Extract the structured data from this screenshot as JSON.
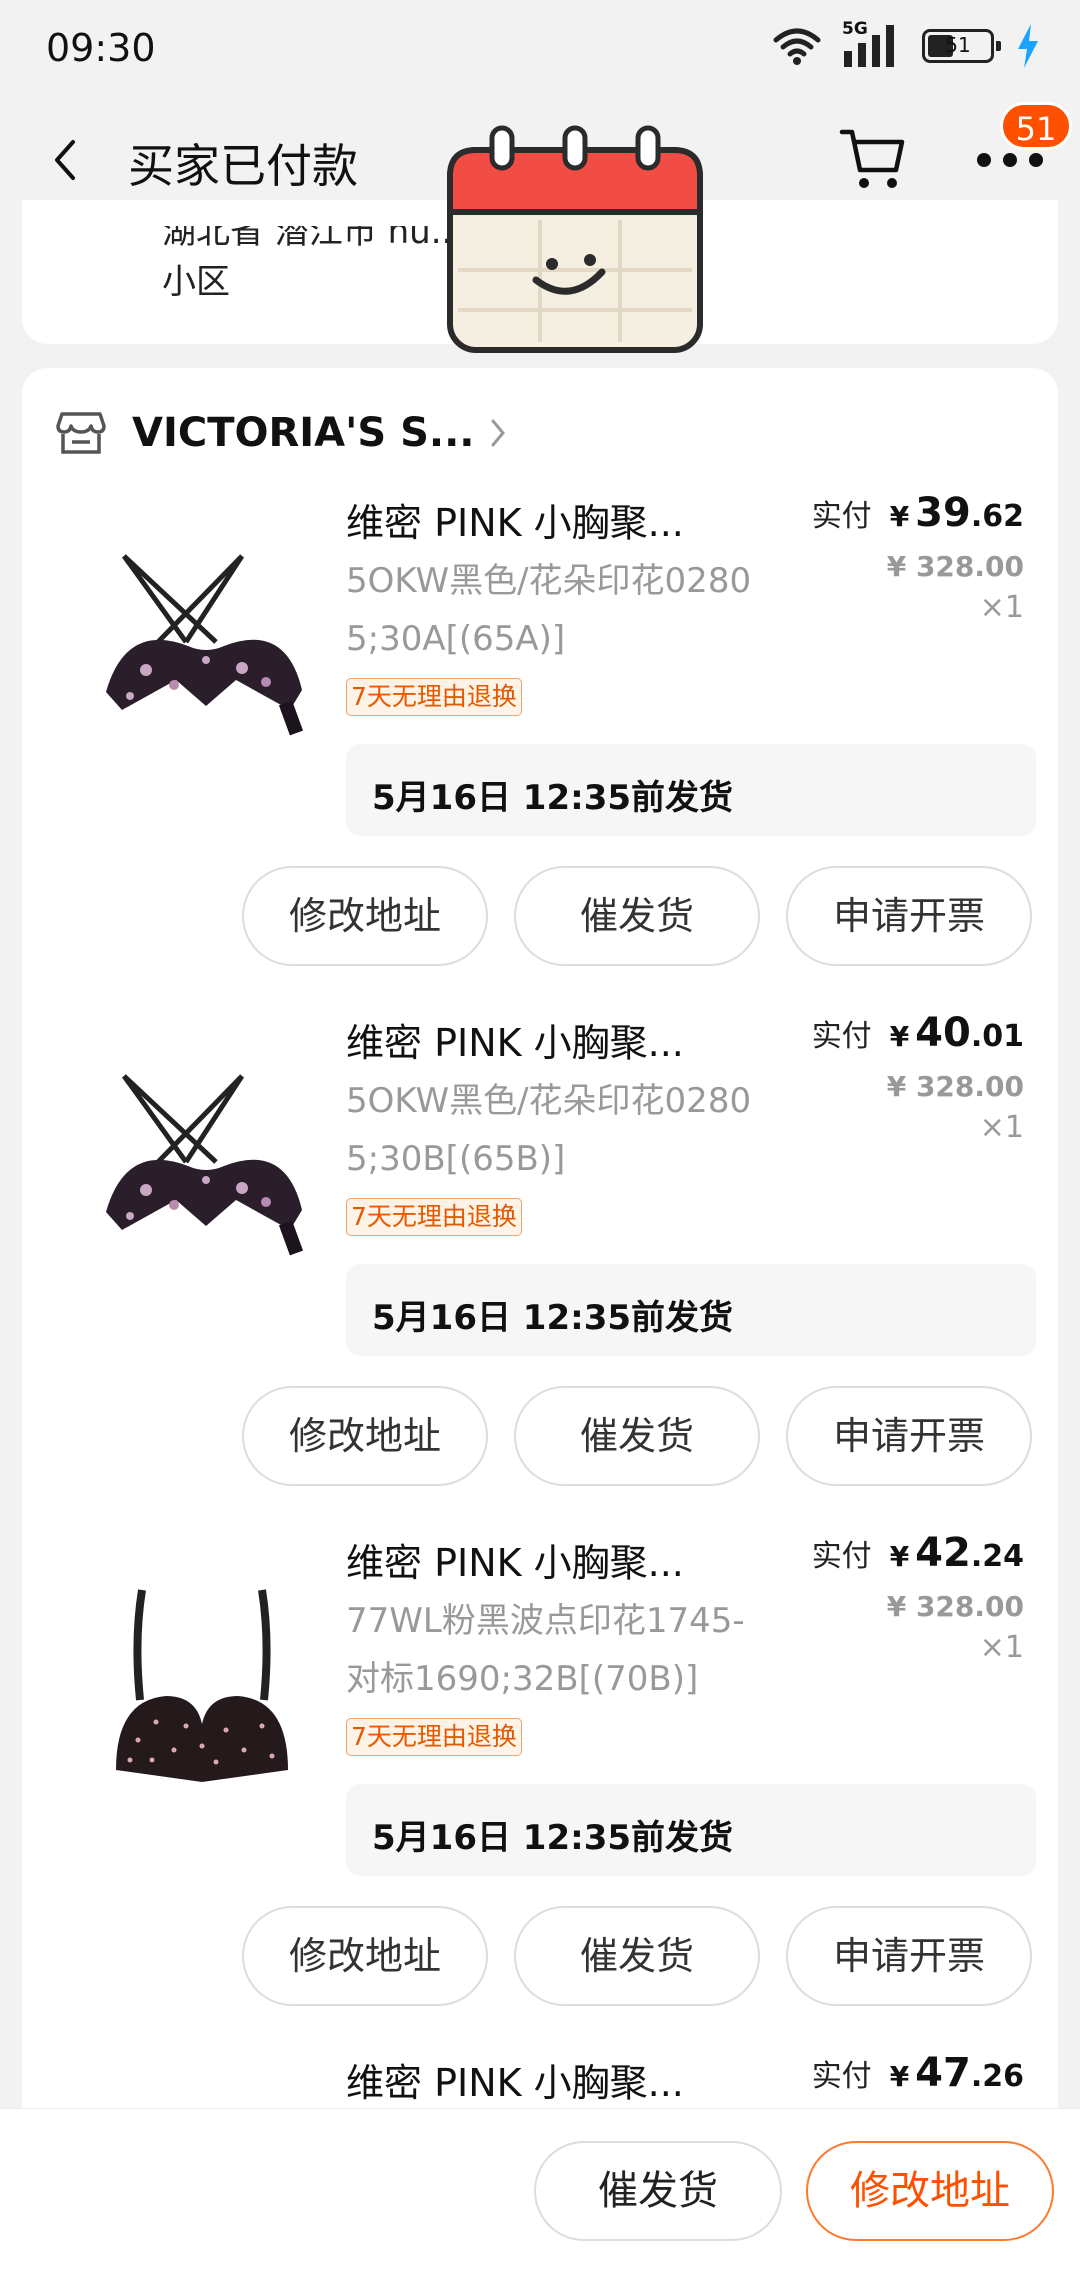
{
  "status_bar": {
    "time": "09:30",
    "network": "5G",
    "battery": "51",
    "icons": [
      "wifi-icon",
      "signal-icon",
      "battery-icon",
      "charging-icon"
    ]
  },
  "nav": {
    "title": "买家已付款",
    "badge": "51",
    "icons": [
      "back-icon",
      "cart-icon",
      "more-icon"
    ]
  },
  "address": {
    "line1": "湖北省 潜江市 hu...",
    "line2": "小区"
  },
  "store": {
    "name": "VICTORIA'S S..."
  },
  "items": [
    {
      "title": "维密 PINK 小胸聚...",
      "spec_line1": "5OKW黑色/花朵印花0280",
      "spec_line2": "5;30A[(65A)]",
      "tag": "7天无理由退换",
      "price_label": "实付",
      "currency": "¥",
      "price_int": "39",
      "price_dec": ".62",
      "orig_price": "¥ 328.00",
      "qty": "×1",
      "ship": "5月16日 12:35前发货",
      "buttons": [
        "修改地址",
        "催发货",
        "申请开票"
      ]
    },
    {
      "title": "维密 PINK 小胸聚...",
      "spec_line1": "5OKW黑色/花朵印花0280",
      "spec_line2": "5;30B[(65B)]",
      "tag": "7天无理由退换",
      "price_label": "实付",
      "currency": "¥",
      "price_int": "40",
      "price_dec": ".01",
      "orig_price": "¥ 328.00",
      "qty": "×1",
      "ship": "5月16日 12:35前发货",
      "buttons": [
        "修改地址",
        "催发货",
        "申请开票"
      ]
    },
    {
      "title": "维密 PINK 小胸聚...",
      "spec_line1": "77WL粉黑波点印花1745-",
      "spec_line2": "对标1690;32B[(70B)]",
      "tag": "7天无理由退换",
      "price_label": "实付",
      "currency": "¥",
      "price_int": "42",
      "price_dec": ".24",
      "orig_price": "¥ 328.00",
      "qty": "×1",
      "ship": "5月16日 12:35前发货",
      "buttons": [
        "修改地址",
        "催发货",
        "申请开票"
      ]
    },
    {
      "title": "维密 PINK 小胸聚...",
      "price_label": "实付",
      "currency": "¥",
      "price_int": "47",
      "price_dec": ".26"
    }
  ],
  "bottom_bar": {
    "urge_label": "催发货",
    "edit_label": "修改地址"
  },
  "colors": {
    "accent": "#ff5000",
    "tag_text": "#e55a00",
    "page_bg": "#f2f2f2"
  }
}
